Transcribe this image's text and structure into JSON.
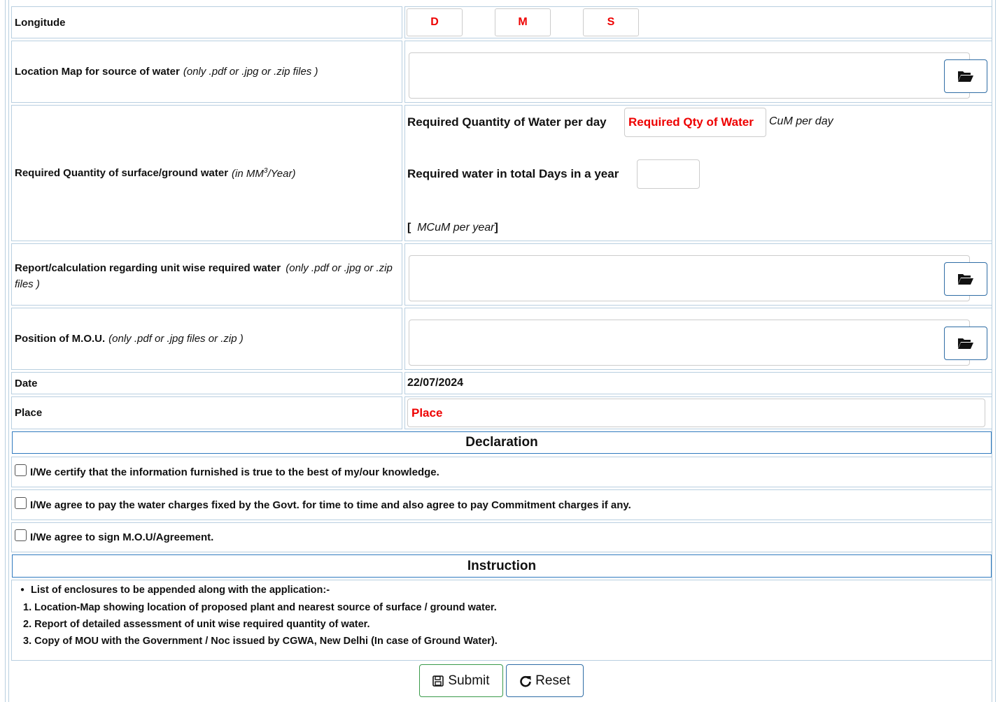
{
  "form": {
    "longitude": {
      "label": "Longitude",
      "d": "D",
      "m": "M",
      "s": "S"
    },
    "location_map": {
      "label": "Location Map for source of water",
      "hint": "(only .pdf or .jpg or .zip files )"
    },
    "quantity": {
      "label": "Required Quantity of surface/ground water",
      "hint_pre": "(in MM",
      "hint_sup": "3",
      "hint_post": "/Year)",
      "per_day_label": "Required Quantity of Water per day",
      "per_day_placeholder": "Required Qty of Water",
      "per_day_unit": "CuM per day",
      "days_label": "Required water in total Days in a year",
      "days_value": "",
      "result_open": "[",
      "result_unit": "MCuM per year",
      "result_close": "]"
    },
    "report": {
      "label": "Report/calculation regarding unit wise required water",
      "hint": "(only .pdf or .jpg or .zip files )"
    },
    "mou": {
      "label": "Position of M.O.U.",
      "hint": "(only .pdf or .jpg files or .zip )"
    },
    "date": {
      "label": "Date",
      "value": "22/07/2024"
    },
    "place": {
      "label": "Place",
      "placeholder": "Place"
    }
  },
  "declaration": {
    "title": "Declaration",
    "items": [
      "I/We certify that the information furnished is true to the best of my/our knowledge.",
      "I/We agree to pay the water charges fixed by the Govt. for time to time and also agree to pay Commitment charges if any.",
      "I/We agree to sign M.O.U/Agreement."
    ]
  },
  "instruction": {
    "title": "Instruction",
    "bullet": "List of enclosures to be appended along with the application:-",
    "items": [
      "1. Location-Map showing location of proposed plant and nearest source of surface / ground water.",
      "2. Report of detailed assessment of unit wise required quantity of water.",
      "3. Copy of MOU with the Government / Noc issued by CGWA, New Delhi (In case of Ground Water)."
    ]
  },
  "buttons": {
    "submit": "Submit",
    "reset": "Reset"
  },
  "colors": {
    "border": "#b9cfe0",
    "section_border": "#2f7abf",
    "placeholder": "#e00000",
    "submit_border": "#3a9a4a",
    "reset_border": "#2f6da5"
  },
  "icons": {
    "folder": "folder-open-icon",
    "save": "floppy-disk-icon",
    "reset": "redo-icon"
  }
}
